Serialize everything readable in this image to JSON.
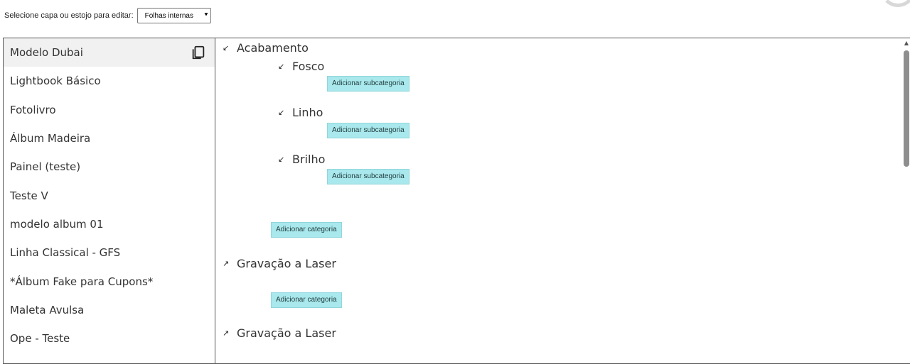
{
  "selector": {
    "label": "Selecione capa ou estojo para editar:",
    "selected": "Folhas internas"
  },
  "sidebar": {
    "items": [
      {
        "label": "Modelo Dubai"
      },
      {
        "label": "Lightbook Básico"
      },
      {
        "label": "Fotolivro"
      },
      {
        "label": "Álbum Madeira"
      },
      {
        "label": "Painel (teste)"
      },
      {
        "label": "Teste V"
      },
      {
        "label": "modelo album 01"
      },
      {
        "label": "Linha Classical - GFS"
      },
      {
        "label": "*Álbum Fake para Cupons*"
      },
      {
        "label": "Maleta Avulsa"
      },
      {
        "label": "Ope - Teste"
      }
    ]
  },
  "tree": {
    "categories": [
      {
        "label": "Acabamento",
        "toggle": "↙",
        "subcategories": [
          {
            "label": "Fosco",
            "toggle": "↙",
            "button": "Adicionar subcategoria"
          },
          {
            "label": "Linho",
            "toggle": "↙",
            "button": "Adicionar subcategoria"
          },
          {
            "label": "Brilho",
            "toggle": "↙",
            "button": "Adicionar subcategoria"
          }
        ],
        "add_button": "Adicionar categoria"
      },
      {
        "label": "Gravação a Laser",
        "toggle": "↗",
        "add_button": "Adicionar categoria"
      },
      {
        "label": "Gravação a Laser",
        "toggle": "↗"
      }
    ]
  },
  "colors": {
    "button_bg": "#a9e8ec",
    "active_item_bg": "#f1f1f1"
  }
}
